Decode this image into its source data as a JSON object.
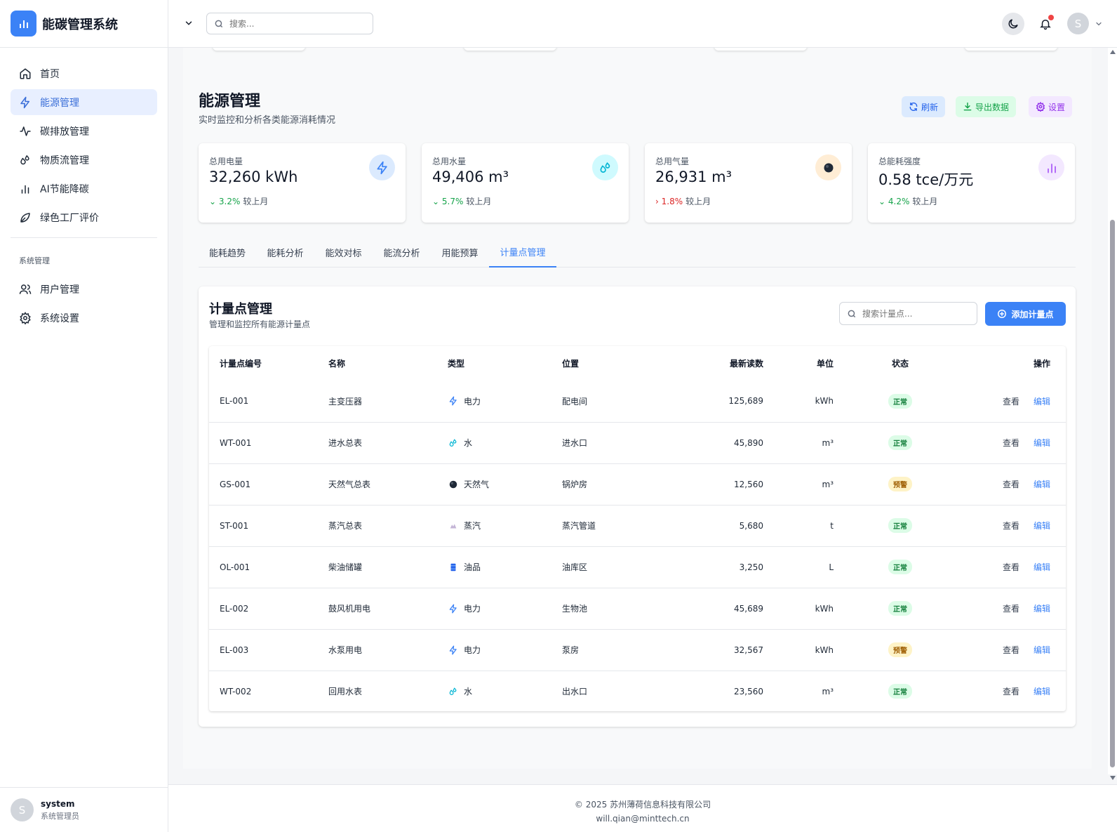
{
  "app": {
    "title": "能碳管理系统",
    "accent": "#3b82f6"
  },
  "sidebar": {
    "items": [
      {
        "label": "首页",
        "icon": "home-icon"
      },
      {
        "label": "能源管理",
        "icon": "zap-icon",
        "active": true
      },
      {
        "label": "碳排放管理",
        "icon": "activity-icon"
      },
      {
        "label": "物质流管理",
        "icon": "droplets-icon"
      },
      {
        "label": "AI节能降碳",
        "icon": "bar-chart-icon"
      },
      {
        "label": "绿色工厂评价",
        "icon": "leaf-icon"
      }
    ],
    "section_label": "系统管理",
    "system_items": [
      {
        "label": "用户管理",
        "icon": "users-icon"
      },
      {
        "label": "系统设置",
        "icon": "gear-icon"
      }
    ],
    "user": {
      "avatar": "S",
      "name": "system",
      "role": "系统管理员"
    }
  },
  "topbar": {
    "search_placeholder": "搜索...",
    "avatar": "S"
  },
  "page": {
    "title": "能源管理",
    "subtitle": "实时监控和分析各类能源消耗情况",
    "actions": {
      "refresh": "刷新",
      "export": "导出数据",
      "settings": "设置"
    }
  },
  "stats": [
    {
      "label": "总用电量",
      "value": "32,260 kWh",
      "delta": "3.2%",
      "trend": "down",
      "compare": "较上月",
      "icon": "zap-icon",
      "color": "#3b82f6"
    },
    {
      "label": "总用水量",
      "value": "49,406 m³",
      "delta": "5.7%",
      "trend": "down",
      "compare": "较上月",
      "icon": "droplets-icon",
      "color": "#06b6d4"
    },
    {
      "label": "总用气量",
      "value": "26,931 m³",
      "delta": "1.8%",
      "trend": "up",
      "compare": "较上月",
      "icon": "gas-dot-icon",
      "color": "#f97316"
    },
    {
      "label": "总能耗强度",
      "value": "0.58 tce/万元",
      "delta": "4.2%",
      "trend": "down",
      "compare": "较上月",
      "icon": "bar-chart-icon",
      "color": "#a855f7"
    }
  ],
  "tabs": [
    "能耗趋势",
    "能耗分析",
    "能效对标",
    "能流分析",
    "用能预算",
    "计量点管理"
  ],
  "active_tab": "计量点管理",
  "meters": {
    "title": "计量点管理",
    "subtitle": "管理和监控所有能源计量点",
    "search_placeholder": "搜索计量点...",
    "add_button": "添加计量点",
    "columns": [
      "计量点编号",
      "名称",
      "类型",
      "位置",
      "最新读数",
      "单位",
      "状态",
      "操作"
    ],
    "view_label": "查看",
    "edit_label": "编辑",
    "rows": [
      {
        "id": "EL-001",
        "name": "主变压器",
        "type": "电力",
        "type_icon": "zap-icon",
        "location": "配电间",
        "reading": "125,689",
        "unit": "kWh",
        "status": "正常",
        "status_kind": "ok"
      },
      {
        "id": "WT-001",
        "name": "进水总表",
        "type": "水",
        "type_icon": "droplets-icon",
        "location": "进水口",
        "reading": "45,890",
        "unit": "m³",
        "status": "正常",
        "status_kind": "ok"
      },
      {
        "id": "GS-001",
        "name": "天然气总表",
        "type": "天然气",
        "type_icon": "gas-dot-icon",
        "location": "锅炉房",
        "reading": "12,560",
        "unit": "m³",
        "status": "预警",
        "status_kind": "warn"
      },
      {
        "id": "ST-001",
        "name": "蒸汽总表",
        "type": "蒸汽",
        "type_icon": "steam-icon",
        "location": "蒸汽管道",
        "reading": "5,680",
        "unit": "t",
        "status": "正常",
        "status_kind": "ok"
      },
      {
        "id": "OL-001",
        "name": "柴油储罐",
        "type": "油品",
        "type_icon": "oil-barrel-icon",
        "location": "油库区",
        "reading": "3,250",
        "unit": "L",
        "status": "正常",
        "status_kind": "ok"
      },
      {
        "id": "EL-002",
        "name": "鼓风机用电",
        "type": "电力",
        "type_icon": "zap-icon",
        "location": "生物池",
        "reading": "45,689",
        "unit": "kWh",
        "status": "正常",
        "status_kind": "ok"
      },
      {
        "id": "EL-003",
        "name": "水泵用电",
        "type": "电力",
        "type_icon": "zap-icon",
        "location": "泵房",
        "reading": "32,567",
        "unit": "kWh",
        "status": "预警",
        "status_kind": "warn"
      },
      {
        "id": "WT-002",
        "name": "回用水表",
        "type": "水",
        "type_icon": "droplets-icon",
        "location": "出水口",
        "reading": "23,560",
        "unit": "m³",
        "status": "正常",
        "status_kind": "ok"
      }
    ]
  },
  "footer": {
    "copyright": "© 2025 苏州薄荷信息科技有限公司",
    "email": "will.qian@minttech.cn"
  }
}
